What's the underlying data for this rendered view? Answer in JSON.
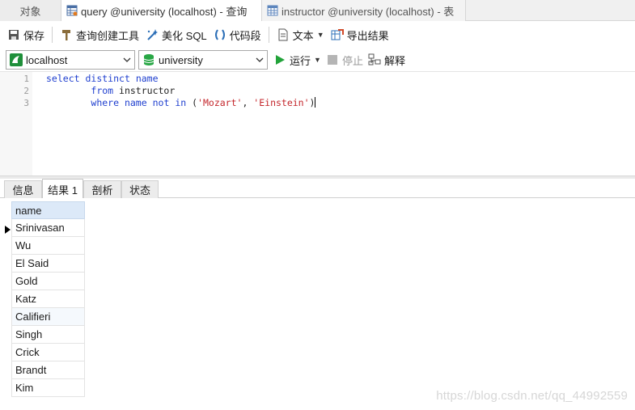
{
  "tabs": {
    "objects": "对象",
    "query": "query @university (localhost) - 查询",
    "table": "instructor @university (localhost) - 表"
  },
  "toolbar": {
    "save": "保存",
    "query_builder": "查询创建工具",
    "beautify_sql": "美化 SQL",
    "code_snippet": "代码段",
    "text": "文本",
    "export_results": "导出结果"
  },
  "toolbar2": {
    "connection": "localhost",
    "database": "university",
    "run": "运行",
    "stop": "停止",
    "explain": "解释"
  },
  "editor": {
    "line_numbers": [
      "1",
      "2",
      "3"
    ],
    "line1_kw1": "select",
    "line1_kw2": "distinct",
    "line1_id": "name",
    "line2_kw": "from",
    "line2_id": "instructor",
    "line3_kw1": "where",
    "line3_id": "name",
    "line3_kw2": "not",
    "line3_kw3": "in",
    "line3_open": "(",
    "line3_str1": "'Mozart'",
    "line3_comma": ", ",
    "line3_str2": "'Einstein'",
    "line3_close": ")"
  },
  "result_tabs": {
    "info": "信息",
    "result1": "结果 1",
    "profile": "剖析",
    "status": "状态"
  },
  "grid": {
    "column": "name",
    "rows": [
      "Srinivasan",
      "Wu",
      "El Said",
      "Gold",
      "Katz",
      "Califieri",
      "Singh",
      "Crick",
      "Brandt",
      "Kim"
    ]
  },
  "watermark": "https://blog.csdn.net/qq_44992559",
  "colors": {
    "keyword": "#1f3fcf",
    "string": "#c4262b",
    "header_bg": "#dce9f8",
    "run_green": "#22a33a"
  }
}
